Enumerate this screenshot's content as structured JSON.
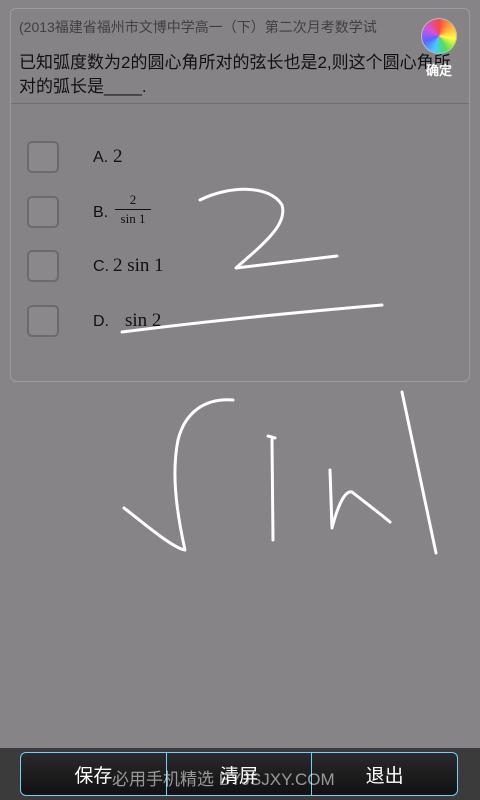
{
  "question": {
    "source": "(2013福建省福州市文博中学高一（下）第二次月考数学试",
    "text": "已知弧度数为2的圆心角所对的弦长也是2,则这个圆心角所对的弧长是____."
  },
  "confirm": {
    "label": "确定",
    "icon": "color-wheel-icon"
  },
  "options": [
    {
      "letter": "A.",
      "text": "2"
    },
    {
      "letter": "B.",
      "numerator": "2",
      "denominator": "sin 1"
    },
    {
      "letter": "C.",
      "text": "2 sin 1"
    },
    {
      "letter": "D.",
      "text": "sin 2"
    }
  ],
  "handwriting": {
    "strokes": "2 / sin1"
  },
  "bottom_bar": {
    "save": "保存",
    "clear": "清屏",
    "exit": "退出",
    "watermark": "必用手机精选 BYJSJXY.COM"
  },
  "colors": {
    "background": "#868487",
    "bar_border": "#6fd0ff",
    "ink": "#ffffff"
  }
}
